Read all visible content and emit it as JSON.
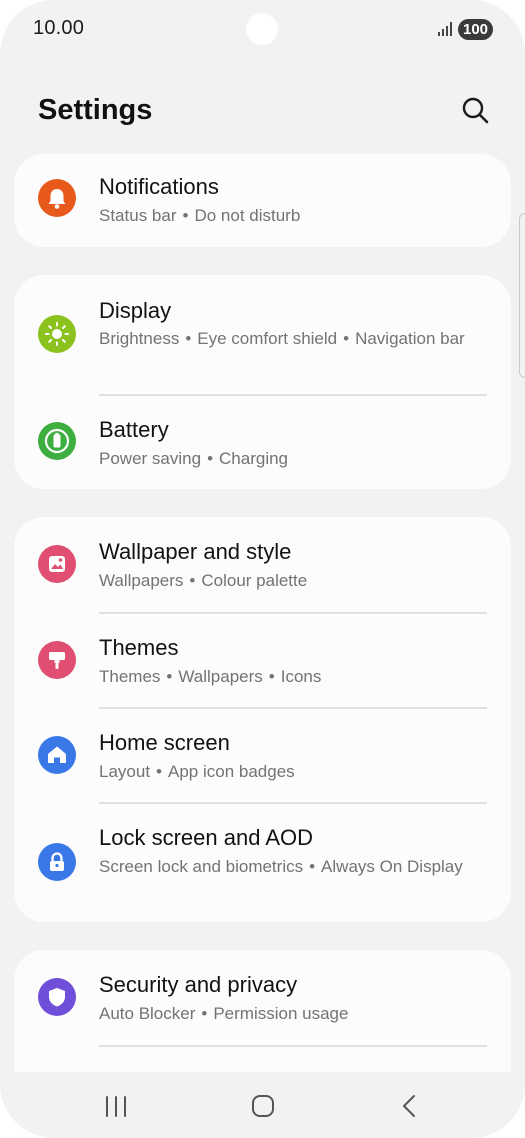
{
  "status_bar": {
    "time": "10.00",
    "battery": "100"
  },
  "header": {
    "title": "Settings",
    "search_icon": "search-icon"
  },
  "items": {
    "notifications": {
      "title": "Notifications",
      "sub": [
        "Status bar",
        "Do not disturb"
      ],
      "icon": "bell-icon",
      "color": "#e8591c"
    },
    "display": {
      "title": "Display",
      "sub": [
        "Brightness",
        "Eye comfort shield",
        "Navigation bar"
      ],
      "icon": "sun-icon",
      "color": "#8cc21e"
    },
    "battery": {
      "title": "Battery",
      "sub": [
        "Power saving",
        "Charging"
      ],
      "icon": "battery-icon",
      "color": "#3dae3f"
    },
    "wallpaper": {
      "title": "Wallpaper and style",
      "sub": [
        "Wallpapers",
        "Colour palette"
      ],
      "icon": "image-icon",
      "color": "#e04e72"
    },
    "themes": {
      "title": "Themes",
      "sub": [
        "Themes",
        "Wallpapers",
        "Icons"
      ],
      "icon": "paint-roller-icon",
      "color": "#e04e72"
    },
    "home": {
      "title": "Home screen",
      "sub": [
        "Layout",
        "App icon badges"
      ],
      "icon": "home-icon",
      "color": "#3a78e8"
    },
    "lock": {
      "title": "Lock screen and AOD",
      "sub": [
        "Screen lock and biometrics",
        "Always On Display"
      ],
      "icon": "lock-icon",
      "color": "#3a78e8"
    },
    "security": {
      "title": "Security and privacy",
      "sub": [
        "Auto Blocker",
        "Permission usage"
      ],
      "icon": "shield-icon",
      "color": "#6f4fd9"
    }
  },
  "nav": {
    "recents": "recents-icon",
    "home": "home-button-icon",
    "back": "back-icon"
  }
}
